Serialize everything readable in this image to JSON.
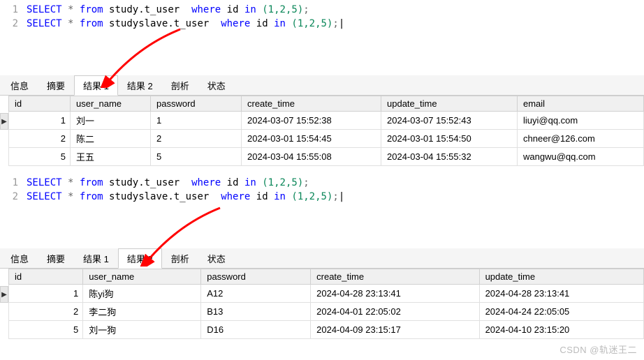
{
  "editor1": {
    "lines": [
      {
        "n": "1",
        "sql": {
          "select": "SELECT",
          "star": "*",
          "from": "from",
          "table": "study.t_user",
          "where": "where",
          "col": "id",
          "in": "in",
          "vals": "(1,2,5)",
          "semi": ";"
        }
      },
      {
        "n": "2",
        "sql": {
          "select": "SELECT",
          "star": "*",
          "from": "from",
          "table": "studyslave.t_user",
          "where": "where",
          "col": "id",
          "in": "in",
          "vals": "(1,2,5)",
          "semi": ";"
        }
      }
    ]
  },
  "editor2": {
    "lines": [
      {
        "n": "1",
        "sql": {
          "select": "SELECT",
          "star": "*",
          "from": "from",
          "table": "study.t_user",
          "where": "where",
          "col": "id",
          "in": "in",
          "vals": "(1,2,5)",
          "semi": ";"
        }
      },
      {
        "n": "2",
        "sql": {
          "select": "SELECT",
          "star": "*",
          "from": "from",
          "table": "studyslave.t_user",
          "where": "where",
          "col": "id",
          "in": "in",
          "vals": "(1,2,5)",
          "semi": ";"
        }
      }
    ]
  },
  "tabs": {
    "info": "信息",
    "summary": "摘要",
    "result1": "结果 1",
    "result2": "结果 2",
    "profile": "剖析",
    "status": "状态"
  },
  "table1": {
    "headers": {
      "id": "id",
      "user_name": "user_name",
      "password": "password",
      "create_time": "create_time",
      "update_time": "update_time",
      "email": "email"
    },
    "rows": [
      {
        "id": "1",
        "user_name": "刘一",
        "password": "1",
        "create_time": "2024-03-07 15:52:38",
        "update_time": "2024-03-07 15:52:43",
        "email": "liuyi@qq.com"
      },
      {
        "id": "2",
        "user_name": "陈二",
        "password": "2",
        "create_time": "2024-03-01 15:54:45",
        "update_time": "2024-03-01 15:54:50",
        "email": "chneer@126.com"
      },
      {
        "id": "5",
        "user_name": "王五",
        "password": "5",
        "create_time": "2024-03-04 15:55:08",
        "update_time": "2024-03-04 15:55:32",
        "email": "wangwu@qq.com"
      }
    ]
  },
  "table2": {
    "headers": {
      "id": "id",
      "user_name": "user_name",
      "password": "password",
      "create_time": "create_time",
      "update_time": "update_time"
    },
    "rows": [
      {
        "id": "1",
        "user_name": "陈yi狗",
        "password": "A12",
        "create_time": "2024-04-28 23:13:41",
        "update_time": "2024-04-28 23:13:41"
      },
      {
        "id": "2",
        "user_name": "李二狗",
        "password": "B13",
        "create_time": "2024-04-01 22:05:02",
        "update_time": "2024-04-24 22:05:05"
      },
      {
        "id": "5",
        "user_name": "刘一狗",
        "password": "D16",
        "create_time": "2024-04-09 23:15:17",
        "update_time": "2024-04-10 23:15:20"
      }
    ]
  },
  "watermark": "CSDN @轨迷王二"
}
